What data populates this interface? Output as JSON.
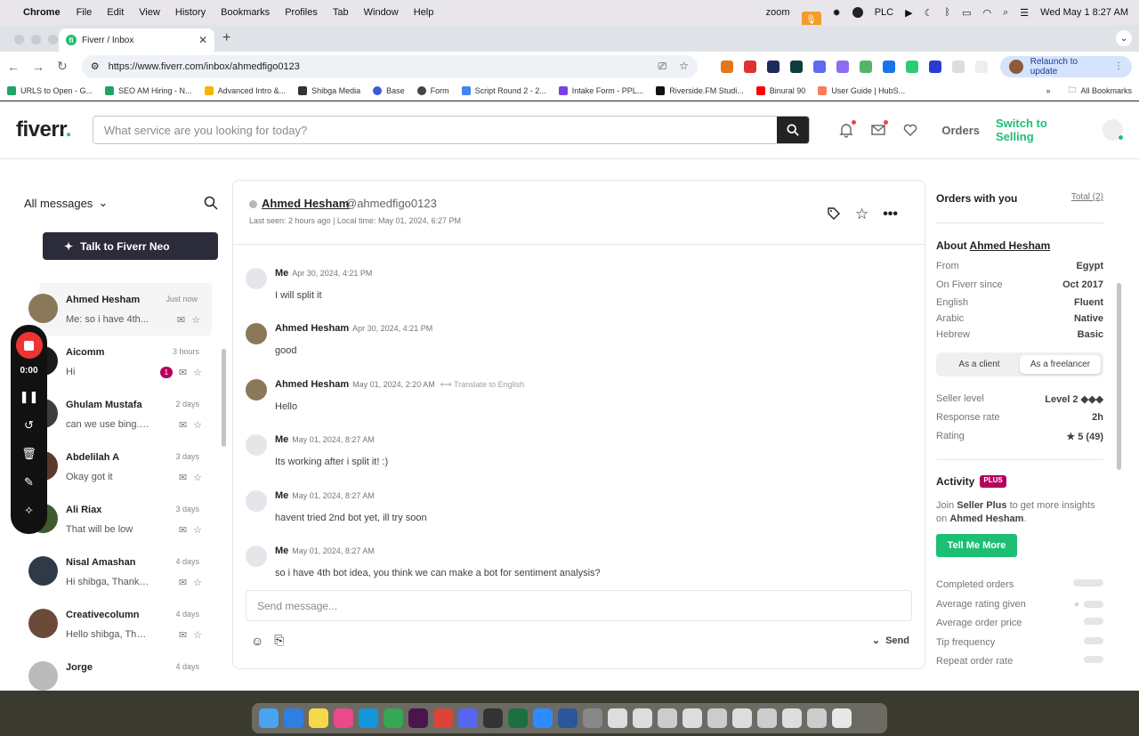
{
  "menubar": {
    "app": "Chrome",
    "menus": [
      "File",
      "Edit",
      "View",
      "History",
      "Bookmarks",
      "Profiles",
      "Tab",
      "Window",
      "Help"
    ],
    "zoom": "zoom",
    "plc": "PLC",
    "clock": "Wed May 1  8:27 AM"
  },
  "browser": {
    "tab_title": "Fiverr / Inbox",
    "url": "https://www.fiverr.com/inbox/ahmedfigo0123",
    "relaunch": "Relaunch to update",
    "bookmarks": [
      {
        "label": "URLS to Open - G...",
        "color": "#21a366"
      },
      {
        "label": "SEO AM Hiring - N...",
        "color": "#21a366"
      },
      {
        "label": "Advanced Intro &...",
        "color": "#f4b400"
      },
      {
        "label": "Shibga Media",
        "color": "#333"
      },
      {
        "label": "Base",
        "color": "#3b5bdb"
      },
      {
        "label": "Form",
        "color": "#444"
      },
      {
        "label": "Script Round 2 - 2...",
        "color": "#4285f4"
      },
      {
        "label": "Intake Form - PPL...",
        "color": "#7b3fe4"
      },
      {
        "label": "Riverside.FM Studi...",
        "color": "#111"
      },
      {
        "label": "Binural 90",
        "color": "#ff0000"
      },
      {
        "label": "User Guide | HubS...",
        "color": "#ff7a59"
      }
    ],
    "all_bookmarks": "All Bookmarks"
  },
  "header": {
    "logo": "fiverr",
    "logo_dot": ".",
    "search_placeholder": "What service are you looking for today?",
    "orders": "Orders",
    "switch": "Switch to Selling"
  },
  "sidebar": {
    "filter": "All messages",
    "neo_button": "Talk to Fiverr Neo",
    "conversations": [
      {
        "name": "Ahmed Hesham",
        "time": "Just now",
        "preview": "Me: so i have 4th...",
        "unread": ""
      },
      {
        "name": "Aicomm",
        "time": "3 hours",
        "preview": "Hi",
        "unread": "1"
      },
      {
        "name": "Ghulam Mustafa",
        "time": "2 days",
        "preview": "can we use bing.co...",
        "unread": ""
      },
      {
        "name": "Abdelilah A",
        "time": "3 days",
        "preview": "Okay got it",
        "unread": ""
      },
      {
        "name": "Ali Riax",
        "time": "3 days",
        "preview": "That will be low",
        "unread": ""
      },
      {
        "name": "Nisal Amashan",
        "time": "4 days",
        "preview": "Hi shibga, Thanks f...",
        "unread": ""
      },
      {
        "name": "Creativecolumn",
        "time": "4 days",
        "preview": "Hello shibga, Than...",
        "unread": ""
      },
      {
        "name": "Jorge",
        "time": "4 days",
        "preview": "",
        "unread": ""
      }
    ]
  },
  "recorder": {
    "time": "0:00"
  },
  "chat": {
    "name": "Ahmed Hesham",
    "handle": "@ahmedfigo0123",
    "last_seen": "Last seen: 2 hours ago",
    "local_time": "Local time: May 01, 2024, 6:27 PM",
    "messages": [
      {
        "sender": "Me",
        "time": "Apr 30, 2024, 4:21 PM",
        "text": "I will split it",
        "translate": ""
      },
      {
        "sender": "Ahmed Hesham",
        "time": "Apr 30, 2024, 4:21 PM",
        "text": "good",
        "translate": ""
      },
      {
        "sender": "Ahmed Hesham",
        "time": "May 01, 2024, 2:20 AM",
        "text": "Hello",
        "translate": "Translate to English"
      },
      {
        "sender": "Me",
        "time": "May 01, 2024, 8:27 AM",
        "text": "Its working after i split it! :)",
        "translate": ""
      },
      {
        "sender": "Me",
        "time": "May 01, 2024, 8:27 AM",
        "text": "havent tried 2nd bot yet, ill try soon",
        "translate": ""
      },
      {
        "sender": "Me",
        "time": "May 01, 2024, 8:27 AM",
        "text": "so i have 4th bot idea, you think we can make a bot for sentiment analysis?",
        "translate": ""
      }
    ],
    "composer_placeholder": "Send message...",
    "send": "Send"
  },
  "right_panel": {
    "orders_title": "Orders with you",
    "total": "Total (2)",
    "about_prefix": "About",
    "about_name": "Ahmed Hesham",
    "info": [
      {
        "label": "From",
        "value": "Egypt"
      },
      {
        "label": "On Fiverr since",
        "value": "Oct 2017"
      },
      {
        "label": "English",
        "value": "Fluent"
      },
      {
        "label": "Arabic",
        "value": "Native"
      },
      {
        "label": "Hebrew",
        "value": "Basic"
      }
    ],
    "toggle": {
      "client": "As a client",
      "freelancer": "As a freelancer"
    },
    "stats": [
      {
        "label": "Seller level",
        "value": "Level 2 ◆◆◆"
      },
      {
        "label": "Response rate",
        "value": "2h"
      },
      {
        "label": "Rating",
        "value": "★ 5 (49)"
      }
    ],
    "activity_title": "Activity",
    "plus_badge": "PLUS",
    "promo_1": "Join",
    "promo_bold": "Seller Plus",
    "promo_2": "to get more insights on",
    "promo_name": "Ahmed Hesham",
    "promo_end": ".",
    "tell_more": "Tell Me More",
    "activity_rows": [
      "Completed orders",
      "Average rating given",
      "Average order price",
      "Tip frequency",
      "Repeat order rate"
    ]
  },
  "colors": {
    "brand_green": "#1dbf73",
    "plus_magenta": "#b5005d",
    "dark_button": "#222325"
  }
}
